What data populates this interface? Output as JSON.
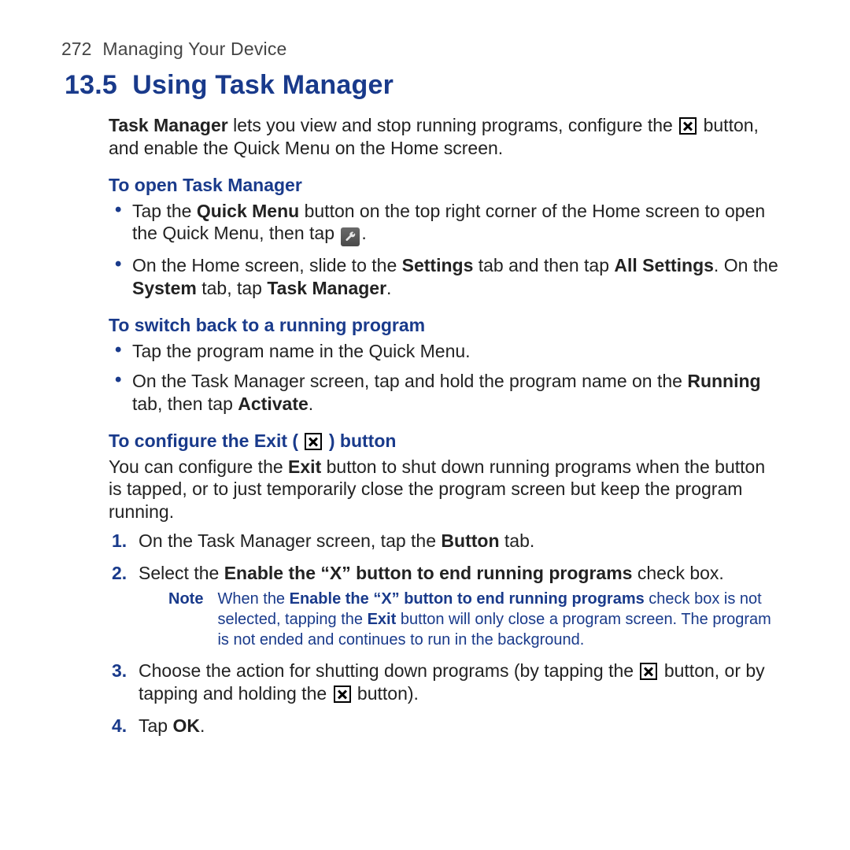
{
  "header": {
    "page": "272",
    "chapter": "Managing Your Device"
  },
  "section": {
    "number": "13.5",
    "title": "Using Task Manager"
  },
  "intro": {
    "a": "Task Manager",
    "b": " lets you view and stop running programs, configure the ",
    "c": " button, and enable the Quick Menu on the Home screen."
  },
  "open": {
    "heading": "To open Task Manager",
    "items": [
      {
        "pre": "Tap the ",
        "b1": "Quick Menu",
        "mid": " button on the top right corner of the Home screen to open the Quick Menu, then tap ",
        "post": "."
      },
      {
        "pre": "On the Home screen, slide to the ",
        "b1": "Settings",
        "mid1": " tab and then tap ",
        "b2": "All Settings",
        "mid2": ". On the ",
        "b3": "System",
        "mid3": " tab, tap ",
        "b4": "Task Manager",
        "post": "."
      }
    ]
  },
  "switch": {
    "heading": "To switch back to a running program",
    "items": [
      {
        "text": "Tap the program name in the Quick Menu."
      },
      {
        "pre": "On the Task Manager screen, tap and hold the program name on the ",
        "b1": "Running",
        "mid": " tab, then tap ",
        "b2": "Activate",
        "post": "."
      }
    ]
  },
  "configure": {
    "heading_pre": "To configure the Exit ( ",
    "heading_post": " ) button",
    "intro_pre": "You can configure the ",
    "intro_b": "Exit",
    "intro_post": " button to shut down running programs when the button is tapped, or to just temporarily close the program screen but keep the program running.",
    "steps": [
      {
        "pre": "On the Task Manager screen, tap the ",
        "b1": "Button",
        "post": " tab."
      },
      {
        "pre": "Select the ",
        "b1": "Enable the “X” button to end running programs",
        "post": " check box."
      },
      {
        "pre": "Choose the action for shutting down programs (by tapping the ",
        "mid": " button, or by tapping and holding the ",
        "post": " button)."
      },
      {
        "pre": "Tap ",
        "b1": "OK",
        "post": "."
      }
    ],
    "note": {
      "label": "Note",
      "pre": "When the ",
      "b1": "Enable the “X” button to end running programs",
      "mid1": " check box is not selected, tapping the ",
      "b2": "Exit",
      "post": " button will only close a program screen. The program is not ended and continues to run in the background."
    }
  }
}
